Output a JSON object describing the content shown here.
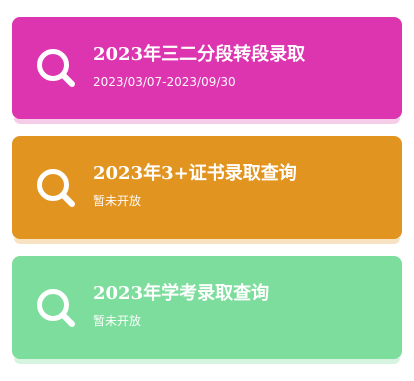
{
  "cards": [
    {
      "title": "2023年三二分段转段录取",
      "subtitle": "2023/03/07-2023/09/30",
      "icon": "search-icon",
      "color": "#dd34b0",
      "shadow": "#f6cde8"
    },
    {
      "title": "2023年3+证书录取查询",
      "subtitle": "暂未开放",
      "icon": "search-icon",
      "color": "#e29420",
      "shadow": "#f8e2c4"
    },
    {
      "title": "2023年学考录取查询",
      "subtitle": "暂未开放",
      "icon": "search-icon",
      "color": "#7ddd9c",
      "shadow": "#d6f4e0"
    }
  ]
}
